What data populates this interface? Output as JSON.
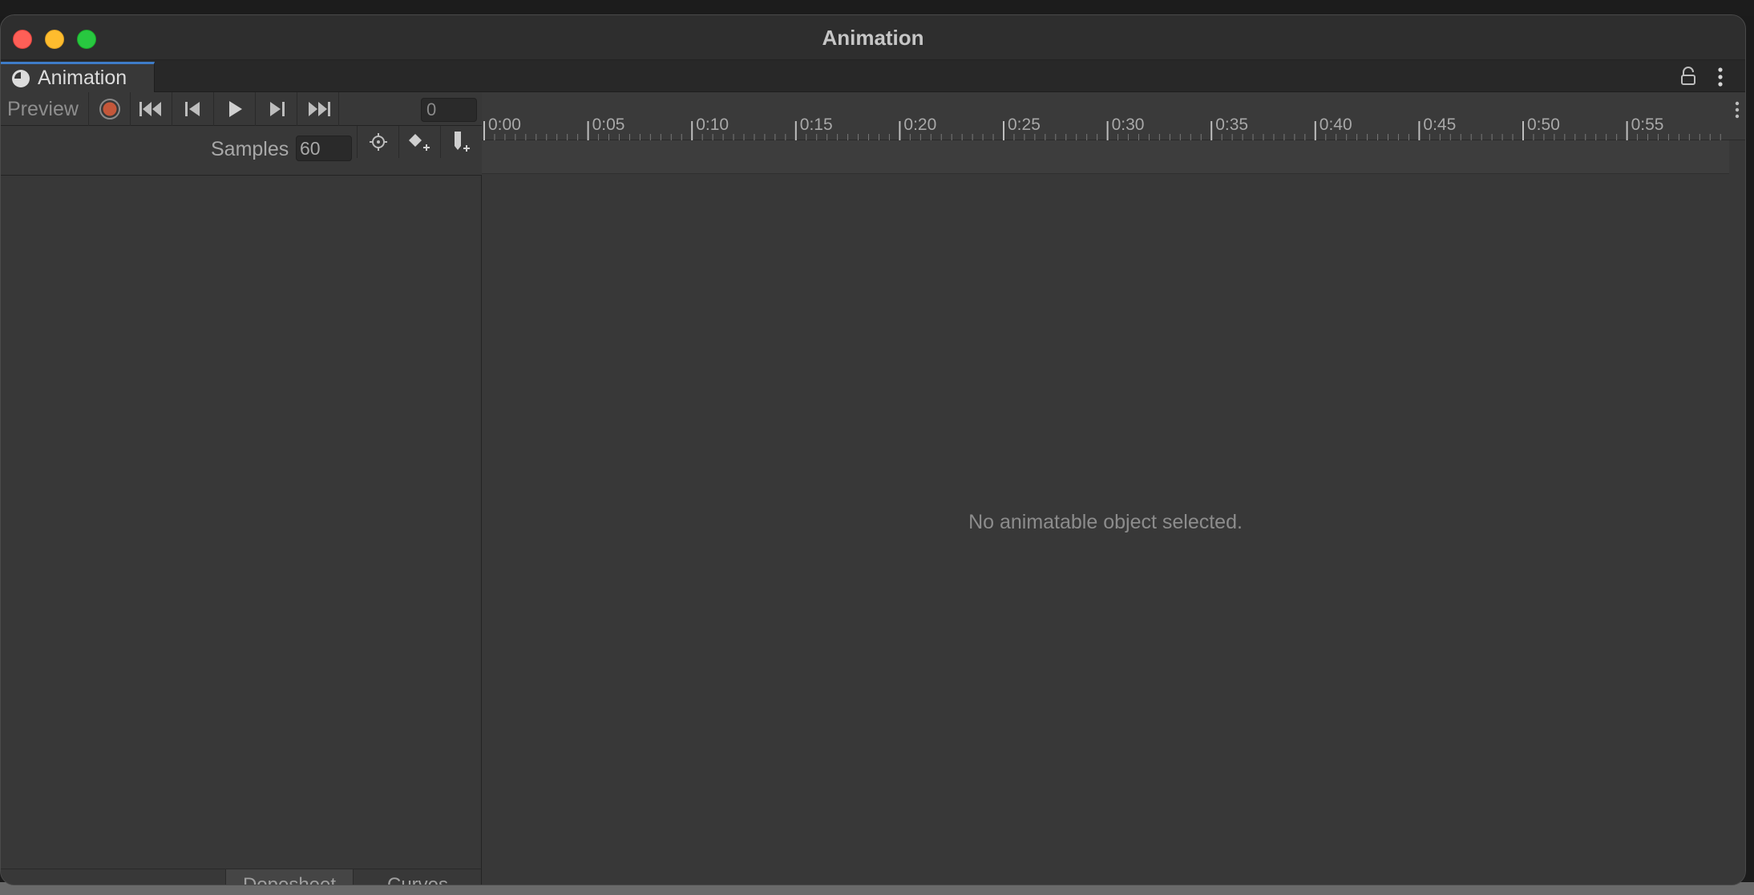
{
  "window": {
    "title": "Animation"
  },
  "tab": {
    "label": "Animation",
    "icon": "clock-icon"
  },
  "toolbar": {
    "preview_label": "Preview",
    "frame_value": "0",
    "buttons": [
      "record-icon",
      "first-keyframe-icon",
      "previous-keyframe-icon",
      "play-icon",
      "next-keyframe-icon",
      "last-keyframe-icon"
    ]
  },
  "samples": {
    "label": "Samples",
    "value": "60"
  },
  "ruler": {
    "labels": [
      "0:00",
      "0:05",
      "0:10",
      "0:15",
      "0:20",
      "0:25",
      "0:30",
      "0:35",
      "0:40",
      "0:45",
      "0:50",
      "0:55"
    ]
  },
  "main": {
    "empty_message": "No animatable object selected."
  },
  "bottom_tabs": {
    "dopesheet": "Dopesheet",
    "curves": "Curves"
  },
  "colors": {
    "record": "#c4573a",
    "accent": "#3e7cc8",
    "close": "#fe5f57",
    "minimize": "#febc2e",
    "maximize": "#28c840"
  }
}
